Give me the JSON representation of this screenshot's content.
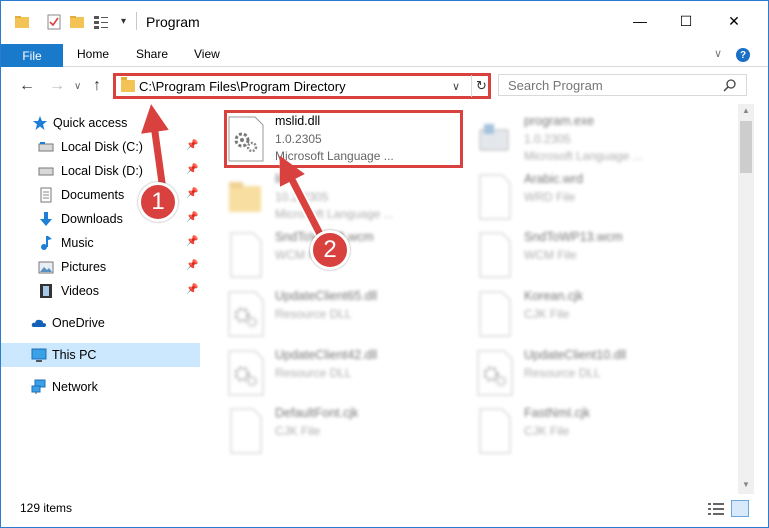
{
  "window": {
    "title": "Program",
    "minimize_glyph": "—",
    "maximize_glyph": "☐",
    "close_glyph": "✕"
  },
  "ribbon": {
    "file": "File",
    "home": "Home",
    "share": "Share",
    "view": "View",
    "help_glyph": "?"
  },
  "address_bar": {
    "path": "C:\\Program Files\\Program Directory"
  },
  "search": {
    "placeholder": "Search Program"
  },
  "sidebar": {
    "items": [
      {
        "label": "Quick access",
        "icon": "star-icon"
      },
      {
        "label": "Local Disk (C:)",
        "icon": "drive-icon",
        "pinned": true
      },
      {
        "label": "Local Disk (D:)",
        "icon": "drive-icon",
        "pinned": true
      },
      {
        "label": "Documents",
        "icon": "documents-icon",
        "pinned": true
      },
      {
        "label": "Downloads",
        "icon": "downloads-icon",
        "pinned": true
      },
      {
        "label": "Music",
        "icon": "music-icon",
        "pinned": true
      },
      {
        "label": "Pictures",
        "icon": "pictures-icon",
        "pinned": true
      },
      {
        "label": "Videos",
        "icon": "videos-icon",
        "pinned": true
      },
      {
        "label": "OneDrive",
        "icon": "onedrive-icon"
      },
      {
        "label": "This PC",
        "icon": "pc-icon",
        "selected": true
      },
      {
        "label": "Network",
        "icon": "network-icon"
      }
    ]
  },
  "files": [
    {
      "name": "mslid.dll",
      "line1": "1.0.2305",
      "line2": "Microsoft Language ...",
      "icon": "dll-gear-icon",
      "highlighted": true
    },
    {
      "name": "program.exe",
      "line1": "1.0.2305",
      "line2": "Microsoft Language ...",
      "icon": "exe-icon"
    },
    {
      "name": "lib",
      "line1": "10.2.2305",
      "line2": "Microsoft Language ...",
      "icon": "folder-icon"
    },
    {
      "name": "Arabic.wrd",
      "line1": "WRD File",
      "icon": "blank-file-icon"
    },
    {
      "name": "SndToWP12.wcm",
      "line1": "WCM File",
      "icon": "blank-file-icon"
    },
    {
      "name": "SndToWP13.wcm",
      "line1": "WCM File",
      "icon": "blank-file-icon"
    },
    {
      "name": "UpdateClient65.dll",
      "line1": "Resource DLL",
      "icon": "dll-gear-icon"
    },
    {
      "name": "Korean.cjk",
      "line1": "CJK File",
      "icon": "blank-file-icon"
    },
    {
      "name": "UpdateClient42.dll",
      "line1": "Resource DLL",
      "icon": "dll-gear-icon"
    },
    {
      "name": "UpdateClient10.dll",
      "line1": "Resource DLL",
      "icon": "dll-gear-icon"
    },
    {
      "name": "DefaultFont.cjk",
      "line1": "CJK File",
      "icon": "blank-file-icon"
    },
    {
      "name": "FastNmI.cjk",
      "line1": "CJK File",
      "icon": "blank-file-icon"
    }
  ],
  "status": {
    "item_count": "129 items"
  },
  "callouts": {
    "step1": "1",
    "step2": "2"
  },
  "colors": {
    "accent": "#1979ca",
    "callout_red": "#d9413f",
    "selected_bg": "#cce8ff"
  }
}
